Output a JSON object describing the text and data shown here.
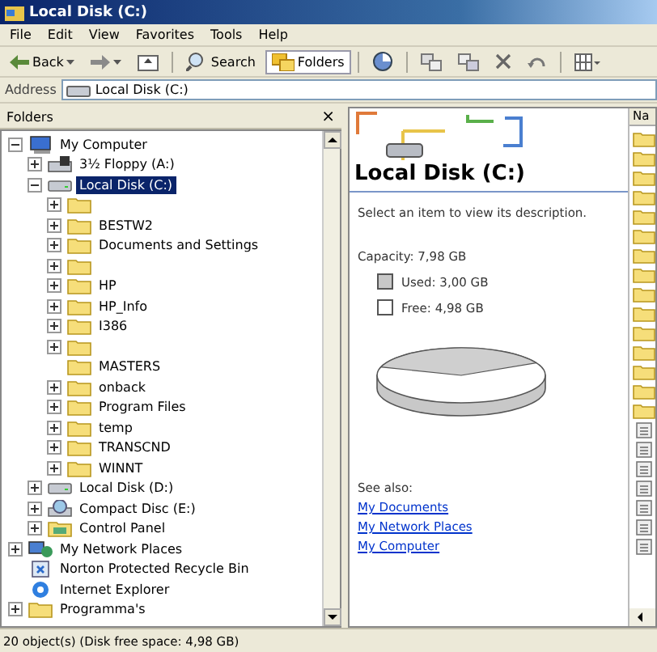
{
  "window": {
    "title": "Local Disk (C:)"
  },
  "menu": [
    "File",
    "Edit",
    "View",
    "Favorites",
    "Tools",
    "Help"
  ],
  "toolbar": [
    {
      "kind": "back",
      "label": "Back",
      "selected": false
    },
    {
      "kind": "forward",
      "selected": false
    },
    {
      "kind": "up",
      "selected": false
    },
    {
      "kind": "search",
      "label": "Search",
      "selected": false
    },
    {
      "kind": "folders",
      "label": "Folders",
      "selected": true
    },
    {
      "kind": "history",
      "selected": false
    },
    {
      "kind": "move",
      "selected": false
    },
    {
      "kind": "copy",
      "selected": false
    },
    {
      "kind": "delete",
      "selected": false
    },
    {
      "kind": "undo",
      "selected": false
    },
    {
      "kind": "views",
      "selected": false
    }
  ],
  "address": {
    "label": "Address",
    "value": "Local Disk (C:)"
  },
  "folders_pane": {
    "title": "Folders",
    "close": "×"
  },
  "tree": [
    {
      "label": "My Computer",
      "kind": "computer",
      "expanded": true,
      "selected": false,
      "children": [
        {
          "label": "3½ Floppy (A:)",
          "kind": "floppy",
          "expanded": false,
          "selected": false
        },
        {
          "label": "Local Disk (C:)",
          "kind": "drive",
          "expanded": true,
          "selected": true,
          "children": [
            {
              "kind": "folder",
              "expanded": false,
              "selected": false
            },
            {
              "label": "BESTW2",
              "kind": "folder",
              "expanded": false,
              "selected": false
            },
            {
              "label": "Documents and Settings",
              "kind": "folder",
              "expanded": false,
              "selected": false
            },
            {
              "kind": "folder",
              "expanded": false,
              "selected": false
            },
            {
              "label": "HP",
              "kind": "folder",
              "expanded": false,
              "selected": false
            },
            {
              "label": "HP_Info",
              "kind": "folder",
              "expanded": false,
              "selected": false
            },
            {
              "label": "I386",
              "kind": "folder",
              "expanded": false,
              "selected": false
            },
            {
              "kind": "folder",
              "expanded": false,
              "selected": false
            },
            {
              "label": "MASTERS",
              "kind": "folder",
              "selected": false
            },
            {
              "label": "onback",
              "kind": "folder",
              "expanded": false,
              "selected": false
            },
            {
              "label": "Program Files",
              "kind": "folder",
              "expanded": false,
              "selected": false
            },
            {
              "label": "temp",
              "kind": "folder",
              "expanded": false,
              "selected": false
            },
            {
              "label": "TRANSCND",
              "kind": "folder",
              "expanded": false,
              "selected": false
            },
            {
              "label": "WINNT",
              "kind": "folder",
              "expanded": false,
              "selected": false
            }
          ]
        },
        {
          "label": "Local Disk (D:)",
          "kind": "drive",
          "expanded": false,
          "selected": false
        },
        {
          "label": "Compact Disc (E:)",
          "kind": "cd",
          "expanded": false,
          "selected": false
        },
        {
          "label": "Control Panel",
          "kind": "control",
          "expanded": false,
          "selected": false
        }
      ]
    },
    {
      "label": "My Network Places",
      "kind": "network",
      "expanded": false,
      "selected": false
    },
    {
      "label": "Norton Protected Recycle Bin",
      "kind": "recycle",
      "selected": false
    },
    {
      "label": "Internet Explorer",
      "kind": "browser",
      "selected": false
    },
    {
      "label": "Programma's",
      "kind": "folder",
      "expanded": false,
      "selected": false
    }
  ],
  "details": {
    "title": "Local Disk (C:)",
    "description": "Select an item to view its description.",
    "capacity": "Capacity: 7,98 GB",
    "used": "Used: 3,00 GB",
    "free": "Free: 4,98 GB",
    "see_also": "See also:",
    "links": [
      "My Documents",
      "My Network Places",
      "My Computer"
    ]
  },
  "file_list": {
    "column": "Na",
    "items": [
      {
        "kind": "folder"
      },
      {
        "kind": "folder"
      },
      {
        "kind": "folder"
      },
      {
        "kind": "folder"
      },
      {
        "kind": "folder"
      },
      {
        "kind": "folder"
      },
      {
        "kind": "folder"
      },
      {
        "kind": "folder"
      },
      {
        "kind": "folder"
      },
      {
        "kind": "folder"
      },
      {
        "kind": "folder"
      },
      {
        "kind": "folder"
      },
      {
        "kind": "folder"
      },
      {
        "kind": "folder"
      },
      {
        "kind": "folder"
      },
      {
        "kind": "file"
      },
      {
        "kind": "file"
      },
      {
        "kind": "file"
      },
      {
        "kind": "file"
      },
      {
        "kind": "file"
      },
      {
        "kind": "file"
      },
      {
        "kind": "file"
      }
    ]
  },
  "status_bar": "20 object(s) (Disk free space: 4,98 GB)"
}
